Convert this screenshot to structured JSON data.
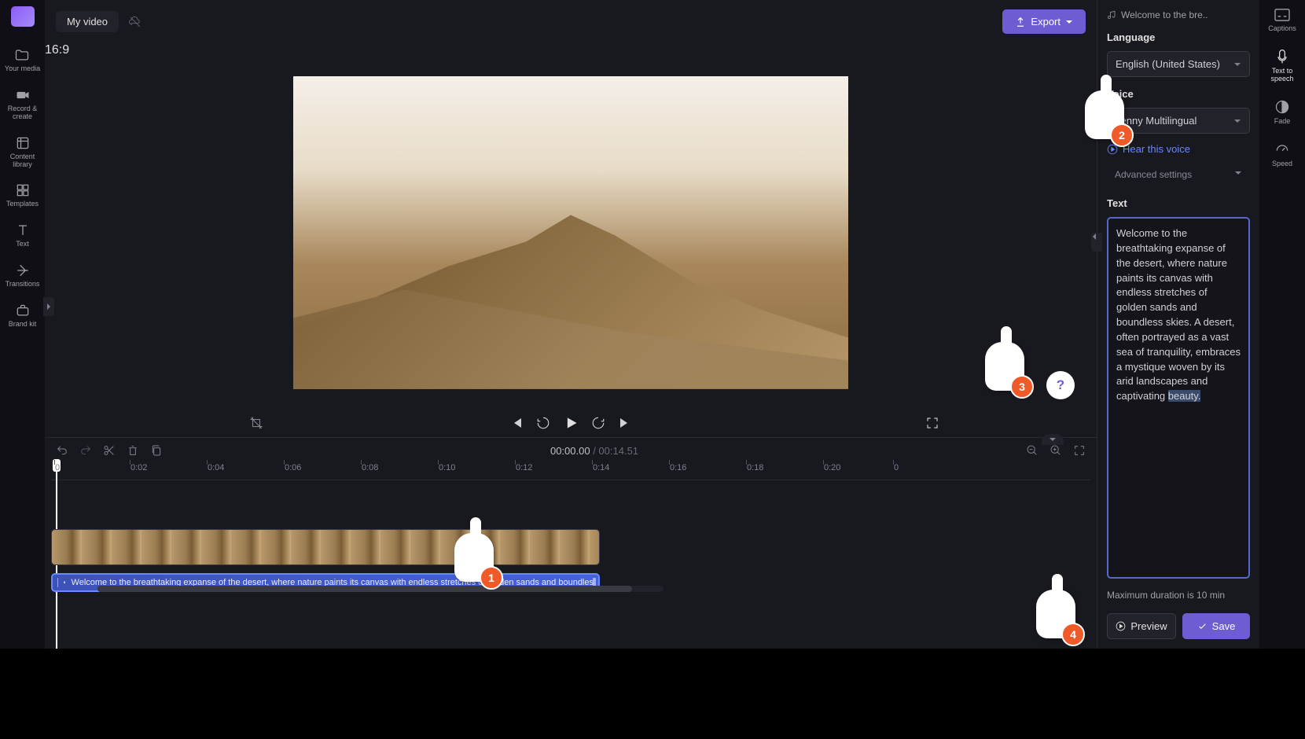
{
  "topBar": {
    "title": "My video",
    "exportLabel": "Export",
    "aspectRatio": "16:9"
  },
  "leftNav": {
    "yourMedia": "Your media",
    "recordCreate": "Record & create",
    "contentLibrary": "Content library",
    "templates": "Templates",
    "text": "Text",
    "transitions": "Transitions",
    "brandKit": "Brand kit"
  },
  "rightNav": {
    "captions": "Captions",
    "textToSpeech": "Text to speech",
    "fade": "Fade",
    "speed": "Speed"
  },
  "player": {
    "currentTime": "00:00.00",
    "separator": " / ",
    "duration": "00:14.51"
  },
  "timeline": {
    "ticks": [
      "0",
      "0:02",
      "0:04",
      "0:06",
      "0:08",
      "0:10",
      "0:12",
      "0:14",
      "0:16",
      "0:18",
      "0:20",
      "0"
    ],
    "audioClipText": "Welcome to the breathtaking expanse of the desert, where nature paints its canvas with endless stretches of golden sands and boundles"
  },
  "ttsPanel": {
    "headerAudio": "Welcome to the bre..",
    "languageLabel": "Language",
    "languageValue": "English (United States)",
    "voiceLabel": "Voice",
    "voiceValue": "Jenny Multilingual",
    "hearVoice": "Hear this voice",
    "advancedSettings": "Advanced settings",
    "textLabel": "Text",
    "textContent": "Welcome to the breathtaking expanse of the desert, where nature paints its canvas with endless stretches of golden sands and boundless skies. A desert, often portrayed as a vast sea of tranquility, embraces a mystique woven by its arid landscapes and captivating ",
    "textHighlighted": "beauty.",
    "maxDuration": "Maximum duration is 10 min",
    "previewLabel": "Preview",
    "saveLabel": "Save"
  },
  "annotations": {
    "hand1": "1",
    "hand2": "2",
    "hand3": "3",
    "hand4": "4"
  }
}
